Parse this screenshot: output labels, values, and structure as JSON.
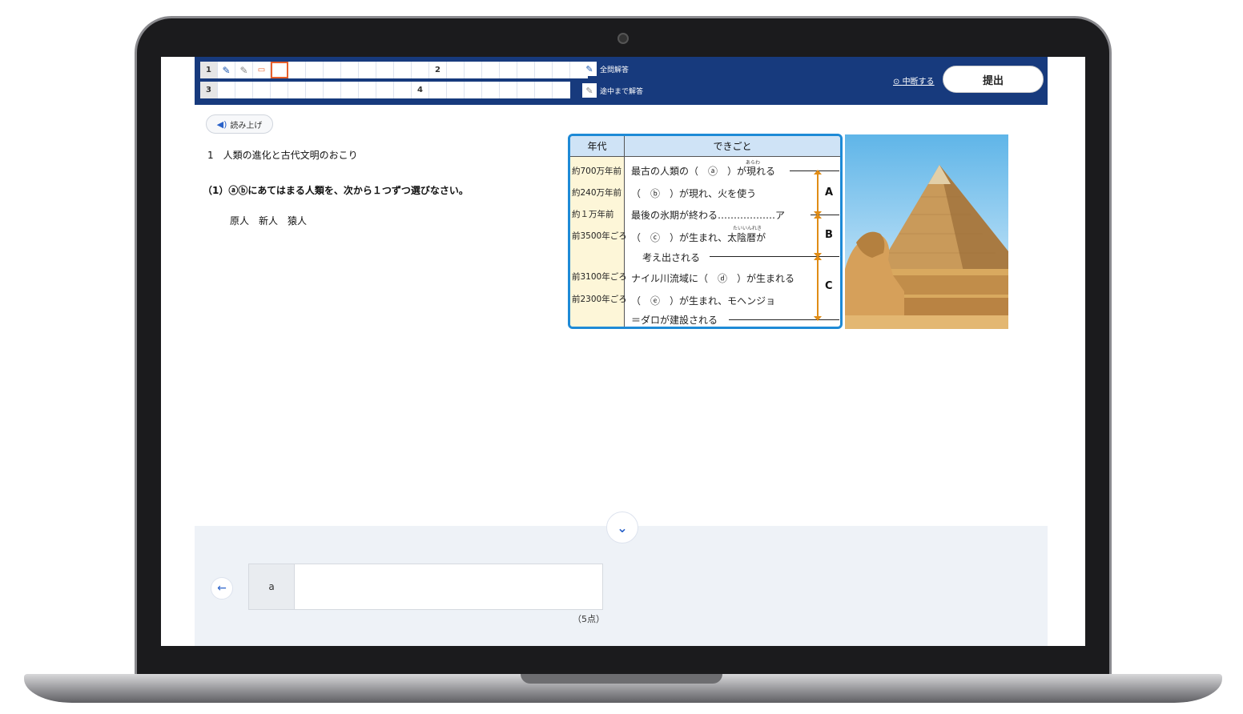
{
  "header": {
    "row1": [
      {
        "num": "1",
        "cells": [
          "✎",
          "✎",
          "▭",
          "",
          "",
          "",
          "",
          "",
          "",
          "",
          ""
        ]
      },
      {
        "num": "2",
        "cells": [
          "",
          "",
          "",
          "",
          "",
          "",
          "",
          ""
        ]
      }
    ],
    "row2": [
      {
        "num": "3",
        "cells": [
          "",
          "",
          "",
          "",
          "",
          "",
          "",
          "",
          "",
          "",
          "",
          ""
        ]
      },
      {
        "num": "4",
        "cells": [
          "",
          "",
          "",
          "",
          "",
          "",
          "",
          ""
        ]
      }
    ],
    "legend_all": "全問解答",
    "legend_partial": "途中まで解答",
    "pause_label": "中断する",
    "submit_label": "提出"
  },
  "read_aloud": "読み上げ",
  "section_title": "1　人類の進化と古代文明のおこり",
  "question": "（1）ⓐⓑにあてはまる人類を、次から１つずつ選びなさい。",
  "choices": "原人　新人　猿人",
  "timeline": {
    "header_year": "年代",
    "header_event": "できごと",
    "years": [
      "約700万年前",
      "約240万年前",
      "約１万年前",
      "前3500年ごろ",
      "前3100年ごろ",
      "前2300年ごろ"
    ],
    "events": [
      "最古の人類の（　ⓐ　）が現れる",
      "（　ⓑ　）が現れ、火を使う",
      "最後の氷期が終わる………………ア",
      "（　ⓒ　）が生まれ、太陰暦が",
      "考え出される",
      "ナイル川流域に（　ⓓ　）が生まれる",
      "（　ⓔ　）が生まれ、モヘンジョ",
      "＝ダロが建設される"
    ],
    "ruby1": "あらわ",
    "ruby2": "たいいんれき",
    "segments": [
      "A",
      "B",
      "C"
    ]
  },
  "answer": {
    "label": "a",
    "value": "",
    "score": "（5点）"
  },
  "colors": {
    "header": "#173a7d",
    "accent": "#1e8ad6",
    "arrow": "#e08c16",
    "active": "#e8602c"
  }
}
